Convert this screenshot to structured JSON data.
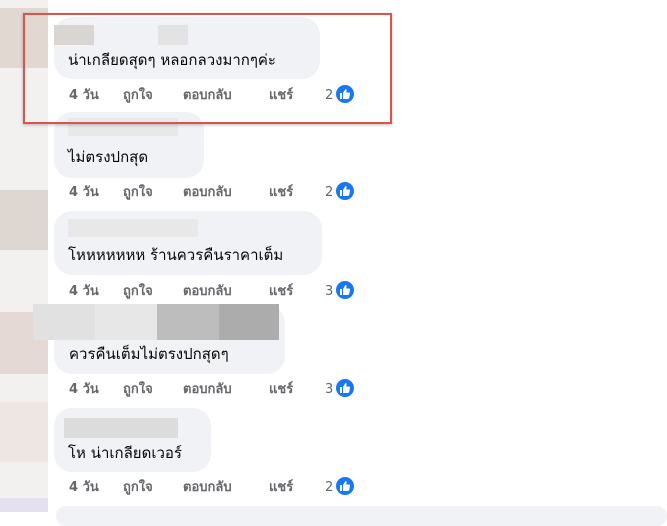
{
  "comments": [
    {
      "text": "น่าเกลียดสุดๆ หลอกลวงมากๆค่ะ",
      "time": "4 วัน",
      "like": "ถูกใจ",
      "reply": "ตอบกลับ",
      "share": "แชร์",
      "reaction_count": "2"
    },
    {
      "text": "ไม่ตรงปกสุด",
      "time": "4 วัน",
      "like": "ถูกใจ",
      "reply": "ตอบกลับ",
      "share": "แชร์",
      "reaction_count": "2"
    },
    {
      "text": "โหหหหหหห ร้านควรคืนราคาเต็ม",
      "time": "4 วัน",
      "like": "ถูกใจ",
      "reply": "ตอบกลับ",
      "share": "แชร์",
      "reaction_count": "3"
    },
    {
      "text": "ควรคืนเต็มไม่ตรงปกสุดๆ",
      "time": "4 วัน",
      "like": "ถูกใจ",
      "reply": "ตอบกลับ",
      "share": "แชร์",
      "reaction_count": "3"
    },
    {
      "text": "โห น่าเกลียดเวอร์",
      "time": "4 วัน",
      "like": "ถูกใจ",
      "reply": "ตอบกลับ",
      "share": "แชร์",
      "reaction_count": "2"
    }
  ],
  "reaction_icon": "thumbs-up-icon",
  "colors": {
    "bubble": "#f0f2f5",
    "action_text": "#65676b",
    "like_blue": "#1877f2",
    "highlight_border": "#d9534f"
  }
}
